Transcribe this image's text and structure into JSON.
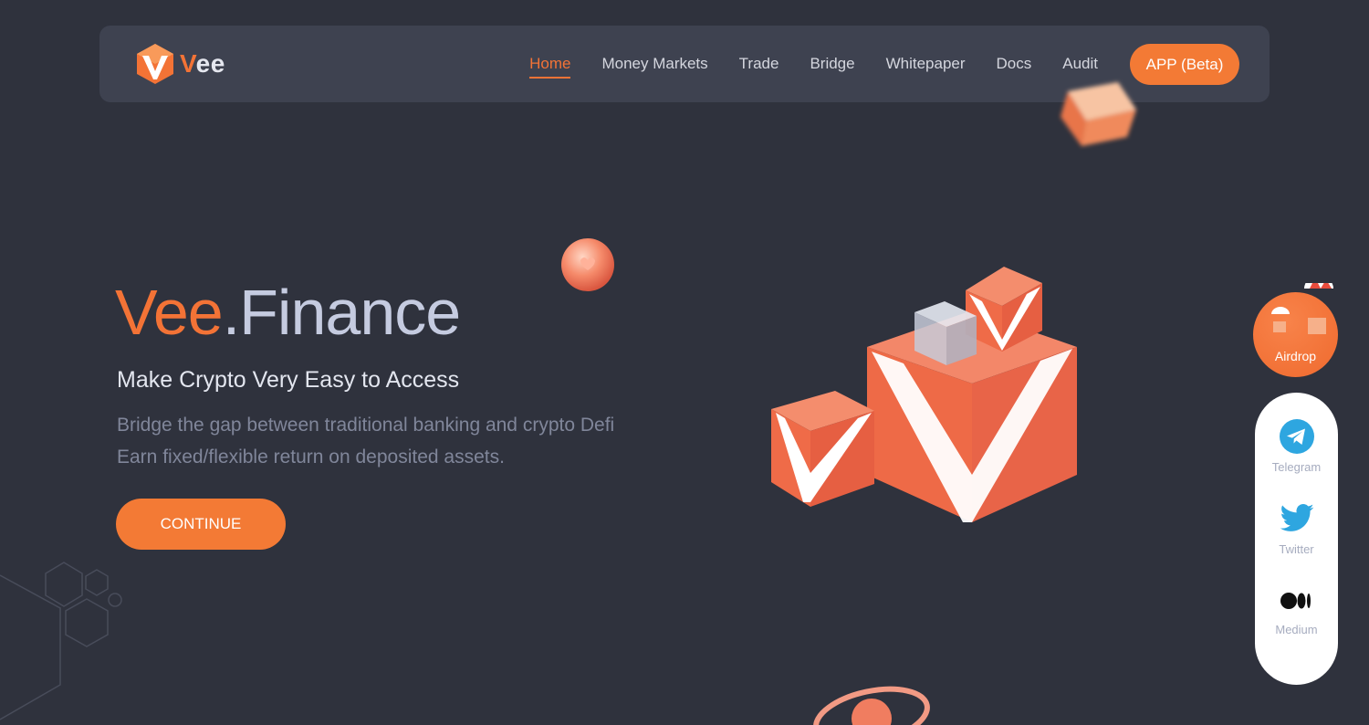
{
  "header": {
    "logo_text_first": "V",
    "logo_text_rest": "ee",
    "nav": [
      {
        "label": "Home",
        "active": true
      },
      {
        "label": "Money Markets",
        "active": false
      },
      {
        "label": "Trade",
        "active": false
      },
      {
        "label": "Bridge",
        "active": false
      },
      {
        "label": "Whitepaper",
        "active": false
      },
      {
        "label": "Docs",
        "active": false
      },
      {
        "label": "Audit",
        "active": false
      }
    ],
    "app_button": "APP (Beta)"
  },
  "hero": {
    "title_brand": "Vee",
    "title_rest": ".Finance",
    "subtitle": "Make Crypto Very Easy to Access",
    "desc_line1": "Bridge the gap between traditional banking and crypto Defi",
    "desc_line2": "Earn fixed/flexible return on deposited assets.",
    "cta": "CONTINUE"
  },
  "sidebar": {
    "airdrop_label": "Airdrop",
    "social": [
      {
        "label": "Telegram",
        "icon": "telegram-icon"
      },
      {
        "label": "Twitter",
        "icon": "twitter-icon"
      },
      {
        "label": "Medium",
        "icon": "medium-icon"
      }
    ]
  },
  "colors": {
    "accent": "#f37336",
    "background": "#2f323d",
    "header_bg": "#3e4250"
  }
}
